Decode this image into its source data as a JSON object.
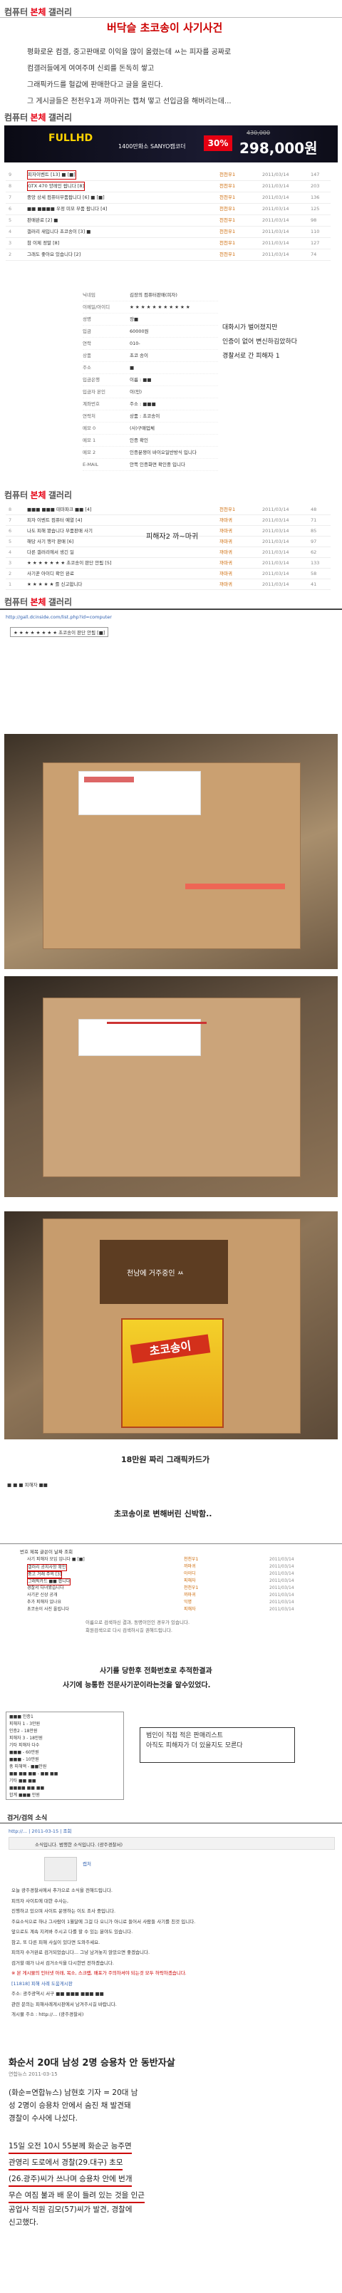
{
  "brand": {
    "name_a": "컴퓨터 ",
    "name_b": "본체 ",
    "name_c": "갤러리"
  },
  "intro": {
    "title": "버닥슬 초코송이 사기사건",
    "lines": [
      "평화로운 컴겔, 중고판매로 이익을 많이 올렸는데 ㅆ는 피자를 공짜로",
      "컴갤러들에게 여여주며 신뢰를 돈독히 쌓고",
      "그래픽카드를 헐값에 판매한다고 글을 올린다.",
      "그 게시글들은 천천우1과 까마귀는 캡쳐 떻고 선입금을 해버리는데..."
    ]
  },
  "ad": {
    "badge": "30%",
    "old_price": "430,000",
    "price": "298,000원",
    "model": "1400만화소 SANYO캠코더",
    "title": "FULLHD"
  },
  "list1": {
    "rows": [
      {
        "no": "9",
        "title": "피자이벤트 [13] ■ [■]",
        "author": "천천우1",
        "date": "2011/03/14",
        "hits": "147"
      },
      {
        "no": "8",
        "title": "GTX 470 양레인 팝니다 [8]",
        "author": "천천우1",
        "date": "2011/03/14",
        "hits": "203"
      },
      {
        "no": "7",
        "title": "중앙 상세 컴퓨터부품팝니다 [6] ■ [■]",
        "author": "천천우1",
        "date": "2011/03/14",
        "hits": "136"
      },
      {
        "no": "6",
        "title": "■■ ■■■■ 우정 미모 부품 팝니다 [4]",
        "author": "천천우1",
        "date": "2011/03/14",
        "hits": "125"
      },
      {
        "no": "5",
        "title": "판매완료 [2] ■",
        "author": "천천우1",
        "date": "2011/03/14",
        "hits": "98"
      },
      {
        "no": "4",
        "title": "갤러리 새입니다 초코송이 [3] ■",
        "author": "천천우1",
        "date": "2011/03/14",
        "hits": "110"
      },
      {
        "no": "3",
        "title": "참 이제 정말 [8]",
        "author": "천천우1",
        "date": "2011/03/14",
        "hits": "127"
      },
      {
        "no": "2",
        "title": "그래도 좋아요 있습니다 [2]",
        "author": "천천우1",
        "date": "2011/03/14",
        "hits": "74"
      }
    ]
  },
  "form": {
    "rows": [
      {
        "k": "닉네임",
        "v": "김장의 컴퓨터판매(피자)"
      },
      {
        "k": "이메일/아이디",
        "v": "★ ★ ★ ★ ★ ★ ★ ★ ★ ★ ★"
      },
      {
        "k": "성명",
        "v": "장■"
      },
      {
        "k": "입금",
        "v": "60000원"
      },
      {
        "k": "연락",
        "v": "010-"
      },
      {
        "k": "상품",
        "v": "초코 송이"
      },
      {
        "k": "주소",
        "v": "■"
      },
      {
        "k": "입금은행",
        "v": "이름 : ■■"
      },
      {
        "k": "입금자 본인",
        "v": "이(민)"
      },
      {
        "k": "계좌번호",
        "v": "주소 : ■■■"
      },
      {
        "k": "연락처",
        "v": "상품 : 초코송이"
      },
      {
        "k": "메모 0",
        "v": "(사)구매업체"
      },
      {
        "k": "메모 1",
        "v": "인증 확인"
      },
      {
        "k": "메모 2",
        "v": "인증분쟁이 바이오일반방식 입니다"
      },
      {
        "k": "E-MAIL",
        "v": "안쪽 인증화면 확인중 입니다"
      }
    ],
    "note": "대화시가 벌어졌지만\n인증이 없어 변신하김았하다\n경찰서로 간 피해자 1"
  },
  "list2": {
    "rows": [
      {
        "no": "8",
        "title": "■■■ ■■■ 테마파크 ■■ [4]",
        "author": "천천우1",
        "date": "2011/03/14",
        "hits": "48"
      },
      {
        "no": "7",
        "title": "피자 이벤트 컴퓨터 예열 [4]",
        "author": "까마귀",
        "date": "2011/03/14",
        "hits": "71"
      },
      {
        "no": "6",
        "title": "나도 피해 봤습니다 부품판매 사기",
        "author": "까마귀",
        "date": "2011/03/14",
        "hits": "85"
      },
      {
        "no": "5",
        "title": "해당 사기 행각 판매 [6]",
        "author": "까마귀",
        "date": "2011/03/14",
        "hits": "97"
      },
      {
        "no": "4",
        "title": "다른 갤러리에서 생긴 일",
        "author": "까마귀",
        "date": "2011/03/14",
        "hits": "62"
      },
      {
        "no": "3",
        "title": "★ ★ ★ ★ ★ ★ ★ 초코송이 판단 안됨 [5]",
        "author": "까마귀",
        "date": "2011/03/14",
        "hits": "133"
      },
      {
        "no": "2",
        "title": "사기꾼 아이디 확인 완료",
        "author": "까마귀",
        "date": "2011/03/14",
        "hits": "58"
      },
      {
        "no": "1",
        "title": "★ ★ ★ ★ ★ 를 신고합니다",
        "author": "까마귀",
        "date": "2011/03/14",
        "hits": "41"
      }
    ],
    "note": "피해자2  까~마귀"
  },
  "list3": {
    "url": "http://gall.dcinside.com/list.php?id=computer",
    "row": "★ ★ ★ ★ ★ ★ ★ ★ 초코송이 판단 안됨 [■]"
  },
  "photo3": {
    "note": "천남에 거주중인 ㅆ"
  },
  "caption1": {
    "text": "18만원 짜리 그래픽카드가",
    "sub": "■ ■ ■ 피해자 ■■"
  },
  "caption2": {
    "text": "초코송이로 변해버린 신박함.."
  },
  "list4": {
    "header": "번호 제목 글쓴이 날짜 조회",
    "rows": [
      {
        "t": "사기 피해자 모임 입니다 ■ [■]",
        "a": "천천우1",
        "d": "2011/03/14"
      },
      {
        "t": "갤러리 공지사항 확인",
        "a": "까마귀",
        "d": "2011/03/14"
      },
      {
        "t": "중고 거래 주의 [3]",
        "a": "아이디",
        "d": "2011/03/14"
      },
      {
        "t": "그래픽카드 ■■ 팝니다",
        "a": "피해자",
        "d": "2011/03/14"
      },
      {
        "t": "경찰서 다녀왔습니다",
        "a": "천천우1",
        "d": "2011/03/14"
      },
      {
        "t": "사기꾼 신상 공개",
        "a": "까마귀",
        "d": "2011/03/14"
      },
      {
        "t": "추가 피해자 있나요",
        "a": "익명",
        "d": "2011/03/14"
      },
      {
        "t": "초코송이 사진 올립니다",
        "a": "피해자",
        "d": "2011/03/14"
      }
    ],
    "footer": "이름으로 검색하신 결과, 동명이인인 경우가 있습니다.\n회원검색으로 다시 검색하시길 권해드립니다."
  },
  "caption3": {
    "line1": "사기를 당한후 전화번호로 추적한결과",
    "line2": "사기에 능통한 전문사기꾼이라는것을 알수있었다."
  },
  "victims": {
    "lines": [
      "■■■ 인증1",
      "피해자 1 - 3만원",
      "인증2 - 18만원",
      "피해자 3 - 18만원",
      "기타 피해자 다수",
      "■■■ - 60만원",
      "■■■ - 10만원",
      "총 피해액 - ■■만원",
      "■■ ■■ ■■ - ■■ ■■",
      "기타 ■■ ■■",
      "■■■■ ■■ ■■",
      "합계 ■■■ 만원"
    ],
    "note": "범인이 직접 적은 판매리스트\n아직도 피해자가 더 있을지도 모른다"
  },
  "news_section": {
    "title": "검거/검의 소식"
  },
  "dc": {
    "url": "http://... | 2011-03-15 | 조회",
    "header": "소식입니다. 범행한 소식입니다. (광주경찰서)",
    "tag": "캡처",
    "lines": [
      "오늘 광주경찰서에서 추가으로 소식을 전해드립니다.",
      "피의자 사이트에 대한 수사는,",
      "진행하고 있으며 사이트 운영하는 이도 조사 중입니다.",
      "주요소식으로 하나 그사람이 1월달에 그걸 다 오니가 아니로 들어서 사람들 사기를 친것 입니다.",
      "앞으로도 계속 지켜봐 주시고 다를 할 수 있는 분야도 있습니다.",
      "참고, 또 다른 피해 사실이 있다면 도와주세요.",
      "피의자 수거완료 검거되었습니다... 그냥 남겨놓지 않았으면 좋겠습니다.",
      "검거할 때가 나서 검거소식을 다시한번 전하겠습니다.",
      "※ 본 게시물의 인터넷 아래, 목소, 스크랩, 배포가 주의하셔야 되는것 모두 허락하겠습니다.",
      "[11818] 피해 사례 도움게시판",
      "주소: 광주광역시 서구 ■■ ■■■ ■■■ ■■",
      "관련 문의는 피해사례게시판에서 남겨주시길 바랍니다.",
      "개시물 주소 : http://... (광주경찰서)"
    ]
  },
  "news": {
    "title": "화순서 20대 남성 2명 승용차 안 동반자살",
    "source": "연합뉴스",
    "date": "2011-03-15",
    "paras": [
      "(화순=연합뉴스) 남현호 기자 = 20대 남",
      "성 2명이 승용차 안에서 숨진 채 발견돼",
      "경찰이 수사에 나섰다.",
      "",
      "15일 오전 10시 55분께 화순군 능주면",
      "관영리 도로에서 경찰(29.대구) 초모",
      "(26.광주)씨가 쓰나며 승용차 안에 번개",
      "무슨 여짐 불과 배 운이 들려 있는 것을 인근",
      "공업사 직원 김모(57)씨가 발견, 경찰에",
      "신고했다."
    ]
  },
  "colors": {
    "red": "#e60012",
    "accent": "#cc0000",
    "link": "#3060b0"
  }
}
